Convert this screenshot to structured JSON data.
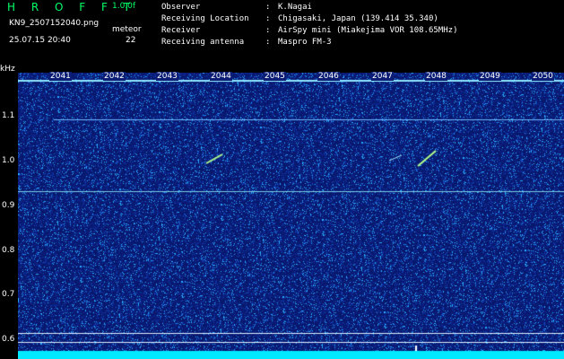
{
  "header": {
    "app_title": "H R O F F T",
    "version": "1.0.0f",
    "filename": "KN9_2507152040.png",
    "mode": "meteor",
    "datetime": "25.07.15 20:40",
    "count": "22"
  },
  "meta": [
    {
      "key": "Observer",
      "value": "K.Nagai"
    },
    {
      "key": "Receiving Location",
      "value": "Chigasaki, Japan (139.414 35.340)"
    },
    {
      "key": "Receiver",
      "value": "AirSpy mini (Miakejima VOR 108.65MHz)"
    },
    {
      "key": "Receiving antenna",
      "value": "Maspro FM-3"
    }
  ],
  "axis": {
    "y_unit": "kHz",
    "y_ticks": [
      "1.1",
      "1.0",
      "0.9",
      "0.8",
      "0.7",
      "0.6"
    ],
    "x_minutes": [
      "2041",
      "2042",
      "2043",
      "2044",
      "2045",
      "2046",
      "2047",
      "2048",
      "2049",
      "2050"
    ]
  },
  "colors": {
    "title_green": "#00ff66",
    "bg_blue": "#0b1d74",
    "noise_cyan": "#00e0ff"
  }
}
